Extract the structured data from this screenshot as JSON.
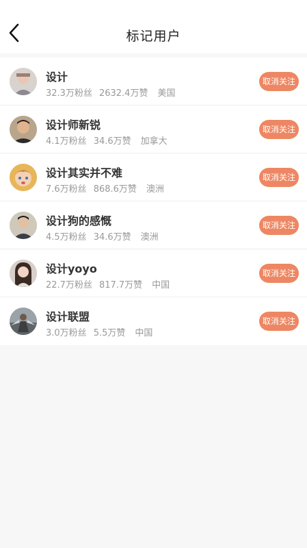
{
  "header": {
    "title": "标记用户",
    "back_icon": "chevron-left-icon"
  },
  "colors": {
    "accent": "#ed8763",
    "background": "#f7f7f7",
    "title_text": "#222222",
    "meta_text": "#999999"
  },
  "users": [
    {
      "name": "设计",
      "fans": "32.3万粉丝",
      "likes": "2632.4万赞",
      "location": "美国",
      "button": "取消关注"
    },
    {
      "name": "设计师新锐",
      "fans": "4.1万粉丝",
      "likes": "34.6万赞",
      "location": "加拿大",
      "button": "取消关注"
    },
    {
      "name": "设计其实并不难",
      "fans": "7.6万粉丝",
      "likes": "868.6万赞",
      "location": "澳洲",
      "button": "取消关注"
    },
    {
      "name": "设计狗的感慨",
      "fans": "4.5万粉丝",
      "likes": "34.6万赞",
      "location": "澳洲",
      "button": "取消关注"
    },
    {
      "name": "设计yoyo",
      "fans": "22.7万粉丝",
      "likes": "817.7万赞",
      "location": "中国",
      "button": "取消关注"
    },
    {
      "name": "设计联盟",
      "fans": "3.0万粉丝",
      "likes": "5.5万赞",
      "location": "中国",
      "button": "取消关注"
    }
  ]
}
